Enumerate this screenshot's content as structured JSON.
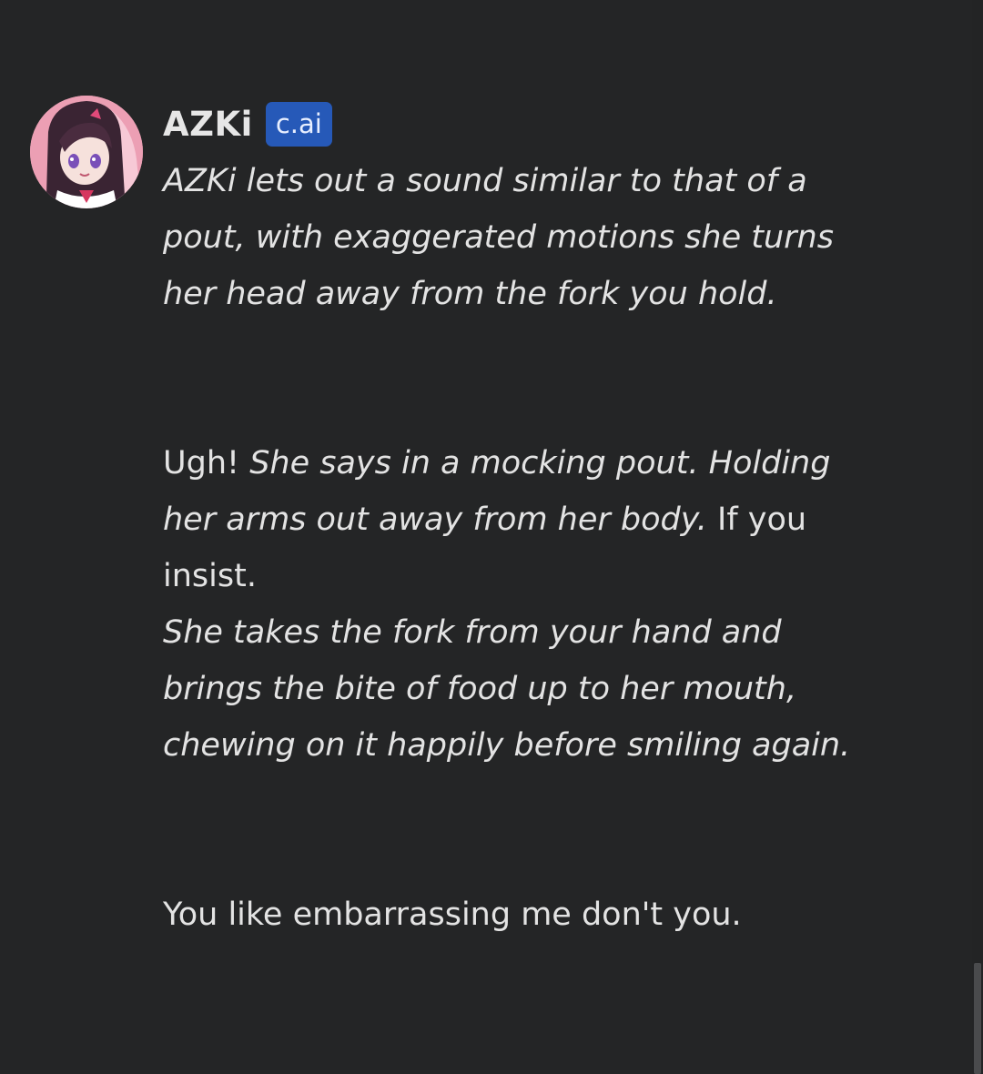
{
  "message": {
    "sender_name": "AZKi",
    "badge": "c.ai",
    "avatar_icon": "character-avatar",
    "paragraph1_italic": "AZKi lets out a sound similar to that of a pout, with exaggerated motions she turns her head away from the fork you hold.",
    "paragraph2": {
      "speech1": "Ugh! ",
      "action1": "She says in a mocking pout. Holding her arms out away from her body.",
      "speech2": " If you insist.",
      "action2": "She takes the fork from your hand and brings the bite of food up to her mouth, chewing on it happily before smiling again."
    },
    "paragraph3": "You like embarrassing me don't you."
  },
  "colors": {
    "background": "#242526",
    "text": "#e3e3e3",
    "badge_bg": "#2659b8"
  }
}
